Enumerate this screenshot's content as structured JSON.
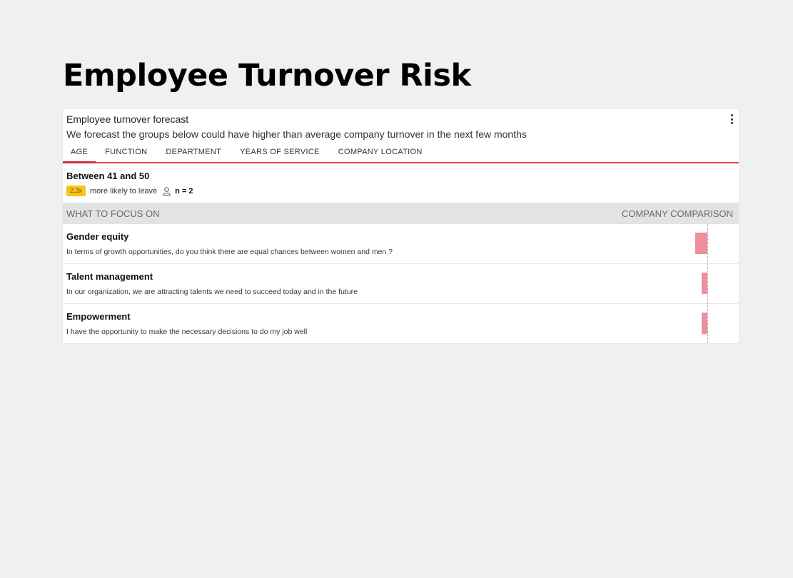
{
  "page": {
    "title": "Employee Turnover Risk"
  },
  "card": {
    "title": "Employee turnover forecast",
    "subtitle": "We forecast the groups below could have higher than average company turnover in the next few months",
    "menu_icon": "kebab-menu-icon"
  },
  "tabs": [
    {
      "label": "AGE",
      "active": true
    },
    {
      "label": "FUNCTION",
      "active": false
    },
    {
      "label": "DEPARTMENT",
      "active": false
    },
    {
      "label": "YEARS OF SERVICE",
      "active": false
    },
    {
      "label": "COMPANY LOCATION",
      "active": false
    }
  ],
  "group": {
    "name": "Between 41 and 50",
    "multiplier": "2.3x",
    "likely_text": "more likely to leave",
    "n_label": "n = 2"
  },
  "focus": {
    "left_header": "WHAT TO FOCUS ON",
    "right_header": "COMPANY COMPARISON",
    "items": [
      {
        "title": "Gender equity",
        "description": "In terms of growth opportunities, do you think there are equal chances between women and men ?",
        "comparison": -17
      },
      {
        "title": "Talent management",
        "description": "In our organization, we are attracting talents we need to succeed today and in the future",
        "comparison": -8
      },
      {
        "title": "Empowerment",
        "description": "I have the opportunity to make the necessary decisions to do my job well",
        "comparison": -8
      }
    ]
  },
  "colors": {
    "accent": "#d32f3f",
    "bar": "#ef8e9c",
    "badge": "#f5c518"
  }
}
